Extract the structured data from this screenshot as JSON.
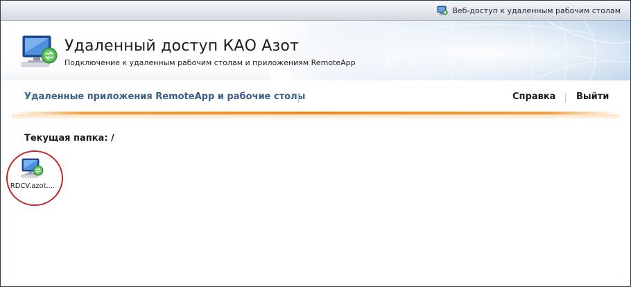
{
  "topbar": {
    "link_label": "Веб-доступ к удаленным рабочим столам",
    "link_icon": "remote-desktop-icon"
  },
  "header": {
    "title": "Удаленный доступ КАО Азот",
    "subtitle": "Подключение к удаленным рабочим столам и приложениям RemoteApp",
    "logo_icon": "remote-desktop-monitor-icon"
  },
  "nav": {
    "main_label": "Удаленные приложения RemoteApp и рабочие столы",
    "help_label": "Справка",
    "logout_label": "Выйти"
  },
  "content": {
    "folder_label": "Текущая папка: /",
    "apps": [
      {
        "label": "RDCV.azot....",
        "icon": "remote-desktop-monitor-icon"
      }
    ]
  },
  "colors": {
    "accent_blue": "#3a5f86",
    "orange_line": "#f08a1e",
    "annotation_red": "#c0262a"
  }
}
